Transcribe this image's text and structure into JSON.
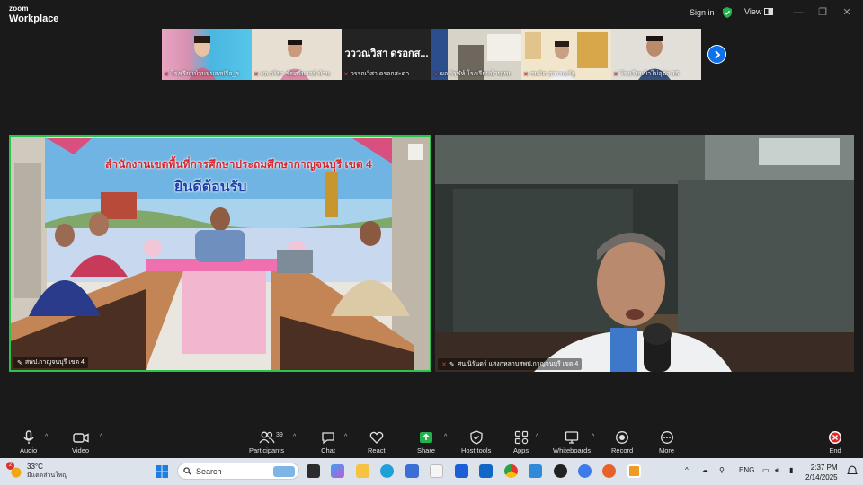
{
  "window": {
    "logo_line1": "zoom",
    "logo_line2": "Workplace",
    "signin": "Sign in",
    "view": "View"
  },
  "gallery": {
    "thumbs": [
      {
        "name": "โรงเรียนบ้านหนองปรือ_ร"
      },
      {
        "name": "ผอ.จริยา ขัยศรีมาลย์ บ้าน"
      },
      {
        "name": "วรรณวิสา ดรอกสะดา",
        "big": "วววณวิสา ดรอกส..."
      },
      {
        "name": "ผอ.วิรุฬห์ โรงเรียนบ้านหน"
      },
      {
        "name": "สมคิด สุวรรณรัฐ"
      },
      {
        "name": "โรงเรียนบ้าไม่อุติส 15"
      }
    ]
  },
  "main": {
    "left_label": "สพป.กาญจนบุรี เขต 4",
    "right_label": "ศน.นิรันดร์ แสงกุหลาบสพป.กาญจนบุรี เขต 4",
    "banner_line1": "สำนักงานเขตพื้นที่การศึกษาประถมศึกษากาญจนบุรี เขต 4",
    "banner_line2": "ยินดีต้อนรับ"
  },
  "toolbar": {
    "audio": "Audio",
    "video": "Video",
    "participants": "Participants",
    "participants_count": "39",
    "chat": "Chat",
    "react": "React",
    "share": "Share",
    "host_tools": "Host tools",
    "apps": "Apps",
    "whiteboards": "Whiteboards",
    "record": "Record",
    "more": "More",
    "end": "End"
  },
  "taskbar": {
    "temp": "33°C",
    "weather_desc": "มีแดดส่วนใหญ่",
    "weather_badge": "2",
    "search": "Search",
    "lang": "ENG",
    "time": "2:37 PM",
    "date": "2/14/2025"
  },
  "colors": {
    "active_border": "#2dc24b",
    "share_green": "#23b14d",
    "zoom_blue": "#0e71eb",
    "end_red": "#e02828"
  }
}
